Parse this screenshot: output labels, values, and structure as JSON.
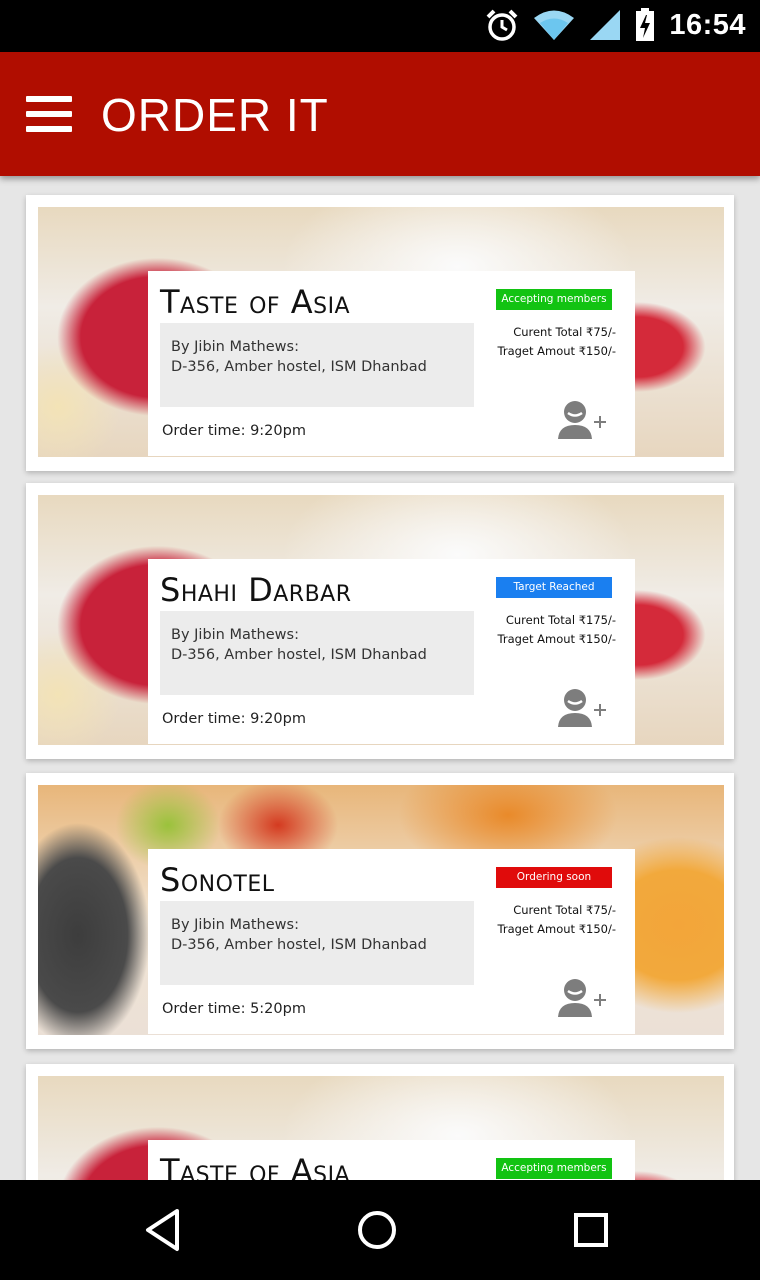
{
  "status_bar": {
    "time": "16:54",
    "icons": [
      "alarm-icon",
      "wifi-icon",
      "signal-icon",
      "battery-charging-icon"
    ]
  },
  "app_bar": {
    "title": "ORDER IT",
    "menu_icon": "hamburger-menu-icon"
  },
  "orders": [
    {
      "restaurant": "Taste of Asia",
      "status": "Accepting members",
      "status_color": "#12c312",
      "by_line": "By Jibin Mathews:",
      "address": "D-356, Amber hostel, ISM Dhanbad",
      "order_time": "Order time:  9:20pm",
      "current_total": "Curent Total ₹75/-",
      "target_amount": "Traget Amout ₹150/-",
      "image": "strawberry-dessert"
    },
    {
      "restaurant": "Shahi Darbar",
      "status": "Target Reached",
      "status_color": "#1a7ff0",
      "by_line": "By Jibin Mathews:",
      "address": "D-356, Amber hostel, ISM Dhanbad",
      "order_time": "Order time:  9:20pm",
      "current_total": "Curent Total ₹175/-",
      "target_amount": "Traget Amout ₹150/-",
      "image": "strawberry-dessert"
    },
    {
      "restaurant": "Sonotel",
      "status": "Ordering soon",
      "status_color": "#e00b0b",
      "by_line": "By Jibin Mathews:",
      "address": "D-356, Amber hostel, ISM Dhanbad",
      "order_time": "Order time:  5:20pm",
      "current_total": "Curent Total ₹75/-",
      "target_amount": "Traget Amout ₹150/-",
      "image": "fruit-bowl"
    },
    {
      "restaurant": "Taste of Asia",
      "status": "Accepting members",
      "status_color": "#12c312",
      "image": "strawberry-dessert"
    }
  ],
  "nav_bar": {
    "buttons": [
      "back-icon",
      "home-icon",
      "recents-icon"
    ]
  },
  "colors": {
    "app_bar": "#b00d00",
    "background": "#e6e6e6"
  }
}
